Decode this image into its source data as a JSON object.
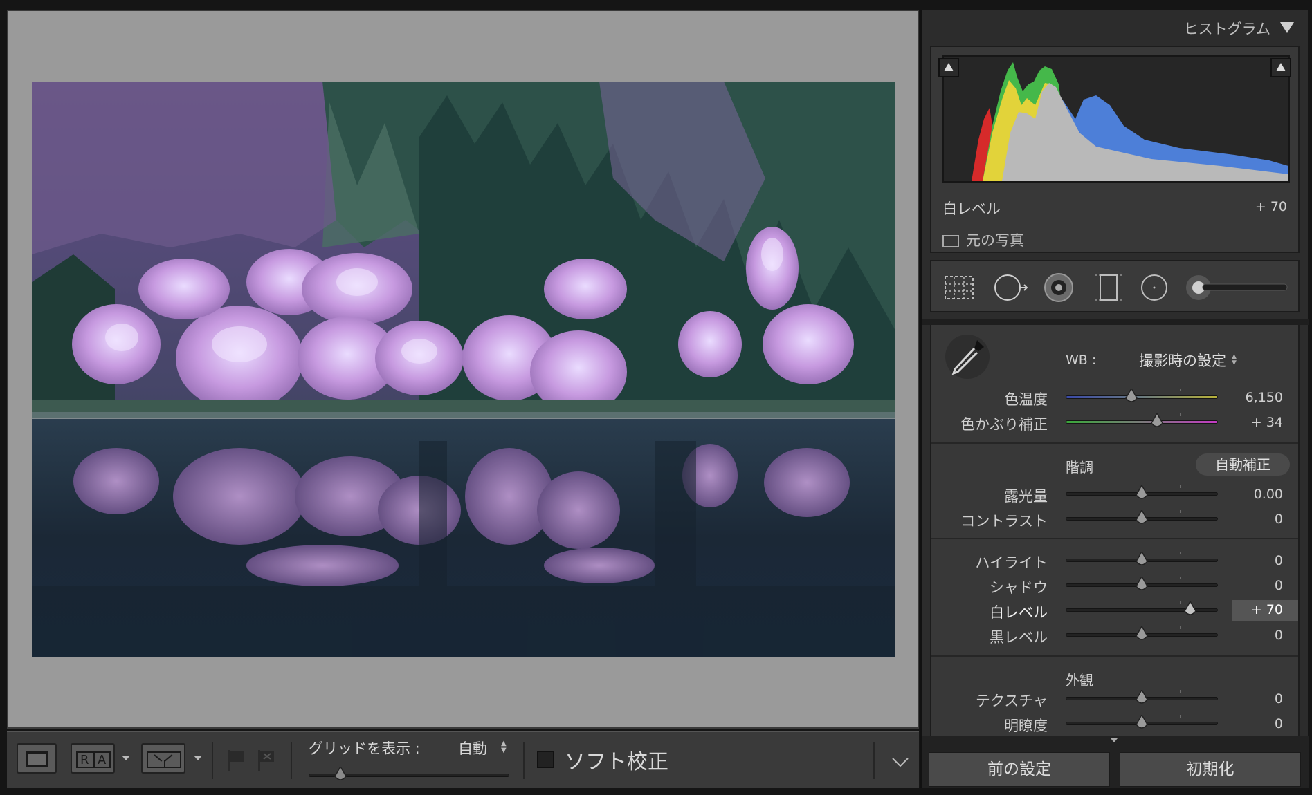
{
  "histogram": {
    "title": "ヒストグラム",
    "info_label": "白レベル",
    "info_value": "+ 70",
    "original_photo_label": "元の写真"
  },
  "tools": [
    "crop-overlay-icon",
    "spot-removal-icon",
    "red-eye-icon",
    "graduated-filter-icon",
    "radial-filter-icon",
    "adjustment-brush-icon"
  ],
  "basic": {
    "wb_label": "WB :",
    "wb_value": "撮影時の設定",
    "temp": {
      "label": "色温度",
      "value": "6,150",
      "level": 0.43
    },
    "tint": {
      "label": "色かぶり補正",
      "value": "+ 34",
      "level": 0.6
    },
    "tone_title": "階調",
    "auto_label": "自動補正",
    "exposure": {
      "label": "露光量",
      "value": "0.00",
      "level": 0.5
    },
    "contrast": {
      "label": "コントラスト",
      "value": "0",
      "level": 0.5
    },
    "highlights": {
      "label": "ハイライト",
      "value": "0",
      "level": 0.5
    },
    "shadows": {
      "label": "シャドウ",
      "value": "0",
      "level": 0.5
    },
    "whites": {
      "label": "白レベル",
      "value": "+ 70",
      "level": 0.82
    },
    "blacks": {
      "label": "黒レベル",
      "value": "0",
      "level": 0.5
    },
    "presence_title": "外観",
    "texture": {
      "label": "テクスチャ",
      "value": "0",
      "level": 0.5
    },
    "clarity": {
      "label": "明瞭度",
      "value": "0",
      "level": 0.5
    }
  },
  "buttons": {
    "previous": "前の設定",
    "reset": "初期化"
  },
  "toolbar": {
    "grid_label": "グリッドを表示 :",
    "grid_value": "自動",
    "grid_level": 0.16,
    "soft_proof_label": "ソフト校正"
  },
  "colors": {
    "viewer_bg": "#9a9a9a",
    "panel_bg": "#383838",
    "blossom": "#c9a2e0",
    "forest": "#274a44",
    "water": "#1d2a3a"
  }
}
